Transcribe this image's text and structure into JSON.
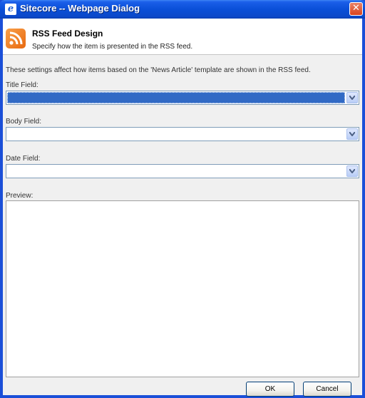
{
  "window": {
    "title": "Sitecore -- Webpage Dialog",
    "title_icon_glyph": "e",
    "close_glyph": "✕",
    "colors": {
      "titlebar": "#0a4fd8",
      "close": "#d9421e",
      "selection": "#316ac5"
    }
  },
  "header": {
    "icon": "rss-feed-icon",
    "title": "RSS Feed Design",
    "subtitle": "Specify how the item is presented in the RSS feed."
  },
  "body": {
    "info": "These settings affect how items based on the 'News Article' template are shown in the RSS feed.",
    "title_field": {
      "label": "Title Field:",
      "value": ""
    },
    "body_field": {
      "label": "Body Field:",
      "value": ""
    },
    "date_field": {
      "label": "Date Field:",
      "value": ""
    },
    "preview_label": "Preview:"
  },
  "buttons": {
    "ok": "OK",
    "cancel": "Cancel"
  }
}
